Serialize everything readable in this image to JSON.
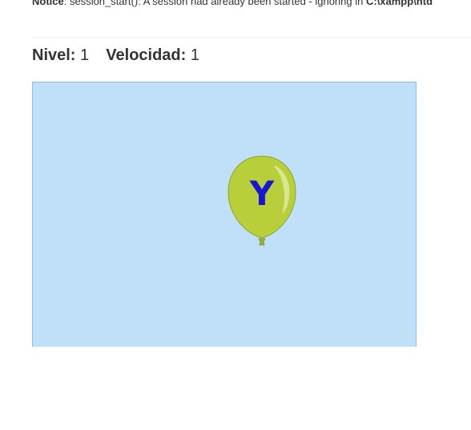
{
  "notice": {
    "label": "Notice",
    "message": ": session_start(): A session had already been started - ignoring in ",
    "path": "C:\\xampp\\htd"
  },
  "stats": {
    "level_label": "Nivel:",
    "level_value": "1",
    "speed_label": "Velocidad:",
    "speed_value": "1"
  },
  "game": {
    "background_color": "#c0e0fa",
    "balloon": {
      "letter": "Y",
      "color": "#b8cf3a",
      "letter_color": "#1616d8"
    }
  }
}
